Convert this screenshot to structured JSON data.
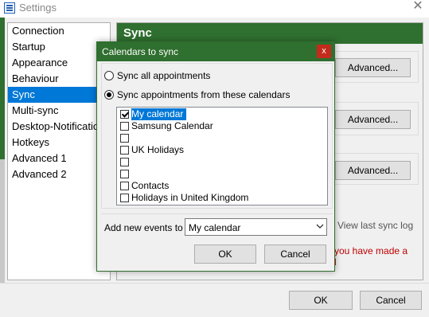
{
  "window": {
    "title": "Settings",
    "close_glyph": "✕"
  },
  "nav": {
    "items": [
      {
        "label": "Connection"
      },
      {
        "label": "Startup"
      },
      {
        "label": "Appearance"
      },
      {
        "label": "Behaviour"
      },
      {
        "label": "Sync",
        "selected": true
      },
      {
        "label": "Multi-sync"
      },
      {
        "label": "Desktop-Notifications"
      },
      {
        "label": "Hotkeys"
      },
      {
        "label": "Advanced 1"
      },
      {
        "label": "Advanced 2"
      }
    ]
  },
  "sync_panel": {
    "title": "Sync",
    "advanced_buttons": [
      "Advanced...",
      "Advanced...",
      "Advanced..."
    ],
    "view_log_label": "View last sync log",
    "warning_text": "you have made a",
    "warning_text_2": "l"
  },
  "footer": {
    "ok_label": "OK",
    "cancel_label": "Cancel"
  },
  "dialog": {
    "title": "Calendars to sync",
    "close_glyph": "x",
    "radio_all": {
      "label": "Sync all appointments",
      "checked": false
    },
    "radio_selected": {
      "label": "Sync appointments from these calendars",
      "checked": true
    },
    "calendars": [
      {
        "label": "My calendar",
        "checked": true,
        "selected": true
      },
      {
        "label": "Samsung Calendar",
        "checked": false
      },
      {
        "label": "",
        "checked": false
      },
      {
        "label": "UK Holidays",
        "checked": false
      },
      {
        "label": "",
        "checked": false
      },
      {
        "label": "",
        "checked": false
      },
      {
        "label": "Contacts",
        "checked": false
      },
      {
        "label": "Holidays in United Kingdom",
        "checked": false
      }
    ],
    "add_events_label": "Add new events to",
    "add_events_value": "My calendar",
    "ok_label": "OK",
    "cancel_label": "Cancel"
  },
  "colors": {
    "accent_green": "#2f6f2f",
    "selection_blue": "#0078d7",
    "close_red": "#c42b1c",
    "warning_red": "#c00000"
  }
}
